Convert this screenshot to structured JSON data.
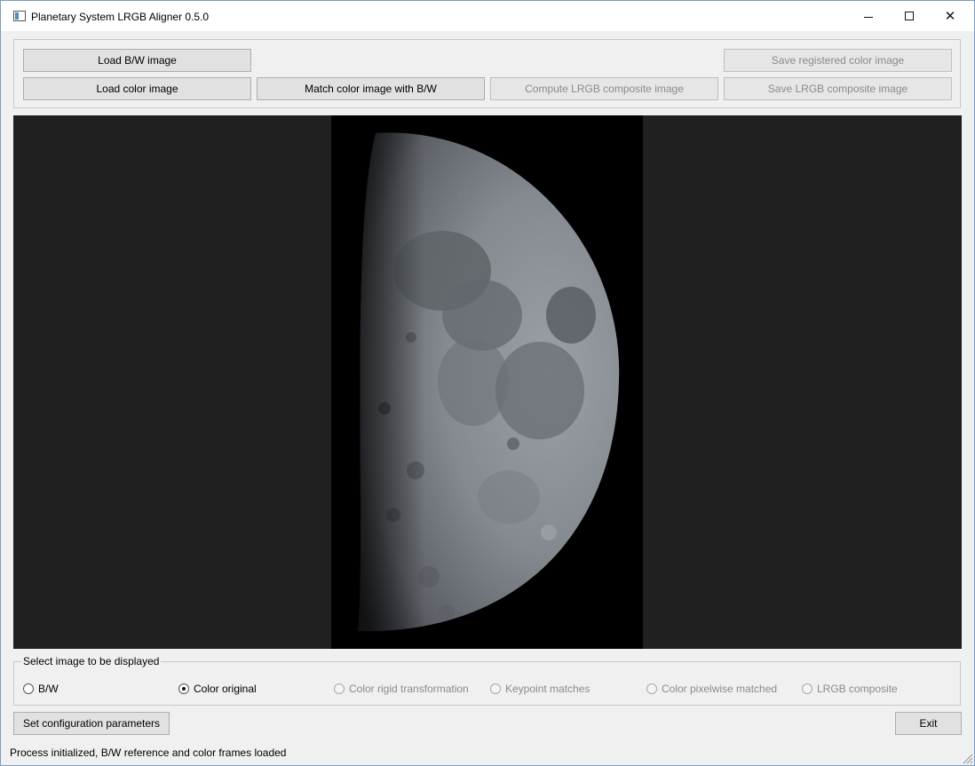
{
  "window": {
    "title": "Planetary System LRGB Aligner 0.5.0",
    "icons": {
      "app": "app-window-icon",
      "minimize": "minimize-icon",
      "maximize": "maximize-icon",
      "close": "close-icon"
    }
  },
  "toolbar": {
    "load_bw": "Load B/W image",
    "load_color": "Load color image",
    "match": "Match color image with B/W",
    "compute": "Compute LRGB composite image",
    "save_registered": "Save registered color image",
    "save_lrgb": "Save LRGB composite image",
    "disabled_buttons": [
      "Compute LRGB composite image",
      "Save registered color image",
      "Save LRGB composite image"
    ]
  },
  "viewer": {
    "content": "moon-photo",
    "background_color": "#202020"
  },
  "display_select": {
    "title": "Select image to be displayed",
    "options": [
      {
        "label": "B/W",
        "checked": false,
        "enabled": true
      },
      {
        "label": "Color original",
        "checked": true,
        "enabled": true
      },
      {
        "label": "Color rigid transformation",
        "checked": false,
        "enabled": false
      },
      {
        "label": "Keypoint matches",
        "checked": false,
        "enabled": false
      },
      {
        "label": "Color pixelwise matched",
        "checked": false,
        "enabled": false
      },
      {
        "label": "LRGB composite",
        "checked": false,
        "enabled": false
      }
    ]
  },
  "footer": {
    "config_button": "Set configuration parameters",
    "exit_button": "Exit",
    "status": "Process initialized, B/W reference and color frames loaded"
  }
}
